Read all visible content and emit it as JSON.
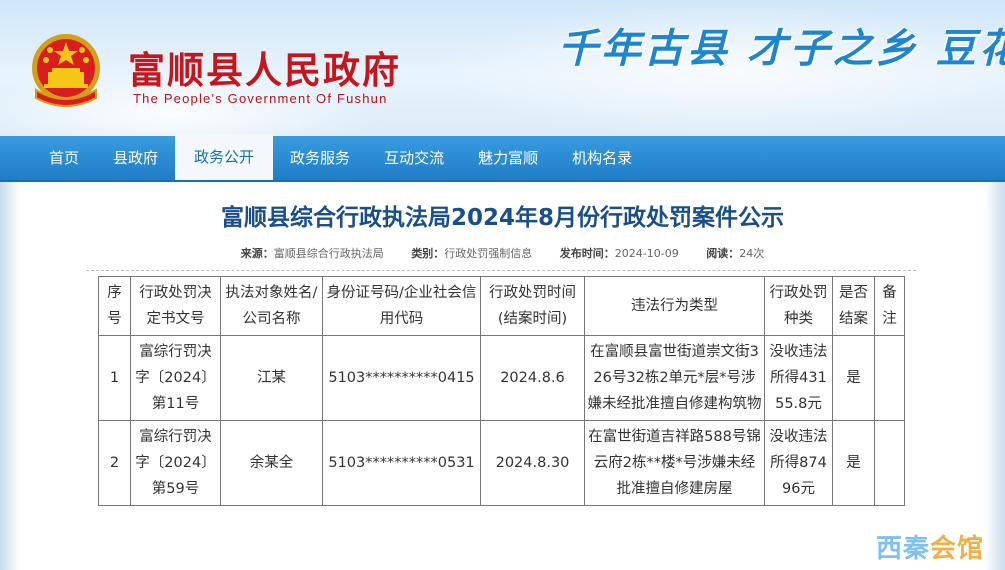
{
  "header": {
    "site_title": "富顺县人民政府",
    "site_subtitle": "The People's Government Of Fushun",
    "slogan": "千年古县  才子之乡  豆花"
  },
  "nav": {
    "items": [
      "首页",
      "县政府",
      "政务公开",
      "政务服务",
      "互动交流",
      "魅力富顺",
      "机构名录"
    ],
    "active": "政务公开"
  },
  "article": {
    "title": "富顺县综合行政执法局2024年8月份行政处罚案件公示",
    "meta": {
      "source_label": "来源：",
      "source": "富顺县综合行政执法局",
      "category_label": "类别：",
      "category": "行政处罚强制信息",
      "published_label": "发布时间：",
      "published": "2024-10-09",
      "views_label": "阅读：",
      "views": "24次"
    }
  },
  "table": {
    "headers": [
      "序号",
      "行政处罚决定书文号",
      "执法对象姓名/公司名称",
      "身份证号码/企业社会信用代码",
      "行政处罚时间(结案时间)",
      "违法行为类型",
      "行政处罚种类",
      "是否结案",
      "备注"
    ],
    "rows": [
      {
        "no": "1",
        "doc": "富综行罚决字〔2024〕第11号",
        "name": "江某",
        "id": "5103**********0415",
        "date": "2024.8.6",
        "violation": "在富顺县富世街道崇文街326号32栋2单元*层*号涉嫌未经批准擅自修建构筑物",
        "penalty": "没收违法所得43155.8元",
        "closed": "是",
        "note": ""
      },
      {
        "no": "2",
        "doc": "富综行罚决字〔2024〕第59号",
        "name": "余某全",
        "id": "5103**********0531",
        "date": "2024.8.30",
        "violation": "在富世街道吉祥路588号锦云府2栋**楼*号涉嫌未经批准擅自修建房屋",
        "penalty": "没收违法所得87496元",
        "closed": "是",
        "note": ""
      }
    ]
  },
  "watermark": {
    "part1": "西秦",
    "part2": "会馆"
  }
}
